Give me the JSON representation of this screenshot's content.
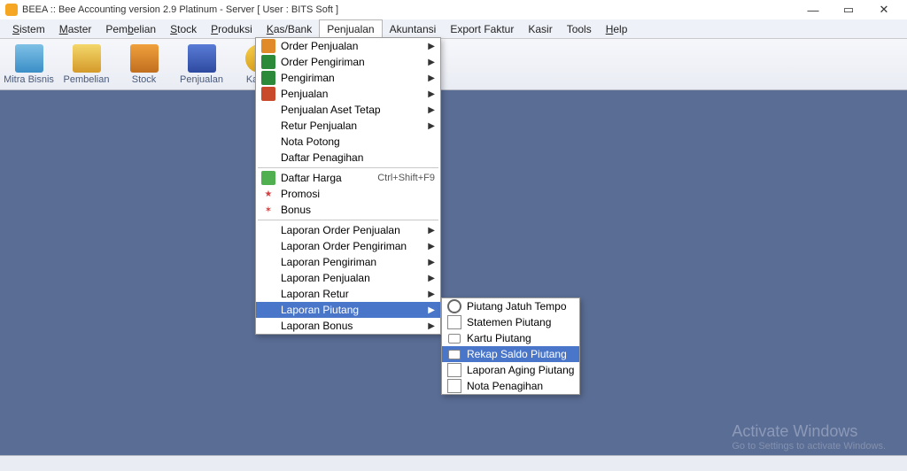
{
  "title": "BEEA :: Bee Accounting version 2.9 Platinum - Server  [ User : BITS Soft ]",
  "menubar": {
    "sistem": "Sistem",
    "master": "Master",
    "pembelian": "Pembelian",
    "stock": "Stock",
    "produksi": "Produksi",
    "kasbank": "Kas/Bank",
    "penjualan": "Penjualan",
    "akuntansi": "Akuntansi",
    "exportfaktur": "Export Faktur",
    "kasir": "Kasir",
    "tools": "Tools",
    "help": "Help"
  },
  "toolbar": {
    "mitra": "Mitra Bisnis",
    "pembelian": "Pembelian",
    "stock": "Stock",
    "penjualan": "Penjualan",
    "kasbank": "Kas/B"
  },
  "menu": {
    "order_penjualan": "Order Penjualan",
    "order_pengiriman": "Order Pengiriman",
    "pengiriman": "Pengiriman",
    "penjualan": "Penjualan",
    "penjualan_aset": "Penjualan Aset Tetap",
    "retur": "Retur Penjualan",
    "nota_potong": "Nota Potong",
    "daftar_penagihan": "Daftar Penagihan",
    "daftar_harga": "Daftar Harga",
    "daftar_harga_sc": "Ctrl+Shift+F9",
    "promosi": "Promosi",
    "bonus": "Bonus",
    "lap_order_penjualan": "Laporan Order Penjualan",
    "lap_order_pengiriman": "Laporan Order Pengiriman",
    "lap_pengiriman": "Laporan Pengiriman",
    "lap_penjualan": "Laporan Penjualan",
    "lap_retur": "Laporan Retur",
    "lap_piutang": "Laporan Piutang",
    "lap_bonus": "Laporan Bonus"
  },
  "submenu": {
    "jatuh_tempo": "Piutang Jatuh Tempo",
    "statemen": "Statemen Piutang",
    "kartu": "Kartu Piutang",
    "rekap": "Rekap Saldo Piutang",
    "aging": "Laporan Aging Piutang",
    "nota": "Nota Penagihan"
  },
  "watermark": {
    "line1": "Activate Windows",
    "line2": "Go to Settings to activate Windows."
  }
}
